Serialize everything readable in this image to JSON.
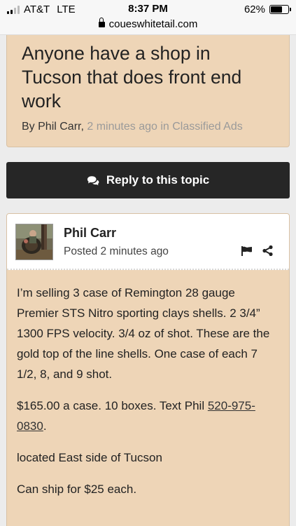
{
  "status": {
    "carrier": "AT&T",
    "network": "LTE",
    "time": "8:37 PM",
    "battery_pct": "62%",
    "battery_level": 0.62
  },
  "url": "coueswhitetail.com",
  "topic": {
    "title": "Anyone have a shop in Tucson that does front end work",
    "by_prefix": "By Phil Carr,",
    "meta": "2 minutes ago in Classified Ads"
  },
  "reply_button": {
    "label": "Reply to this topic",
    "icon": "chat-bubbles-icon"
  },
  "post": {
    "author": "Phil Carr",
    "posted": "Posted 2 minutes ago",
    "icons": [
      "flag-icon",
      "share-icon"
    ],
    "para1": "I’m selling 3 case of Remington 28 gauge Premier STS Nitro sporting clays shells. 2 3/4” 1300 FPS velocity. 3/4 oz of shot. These are the gold top of the line shells. One case of each 7 1/2, 8, and 9 shot.",
    "para2_text": "$165.00 a case. 10 boxes. Text Phil ",
    "para2_phone": "520-975-0830",
    "para2_end": ".",
    "para3": "located East side of Tucson",
    "para4": "Can ship for $25 each."
  },
  "colors": {
    "card_bg": "#eed5b7",
    "button_bg": "#262626",
    "meta_text": "#9a9a9a"
  }
}
